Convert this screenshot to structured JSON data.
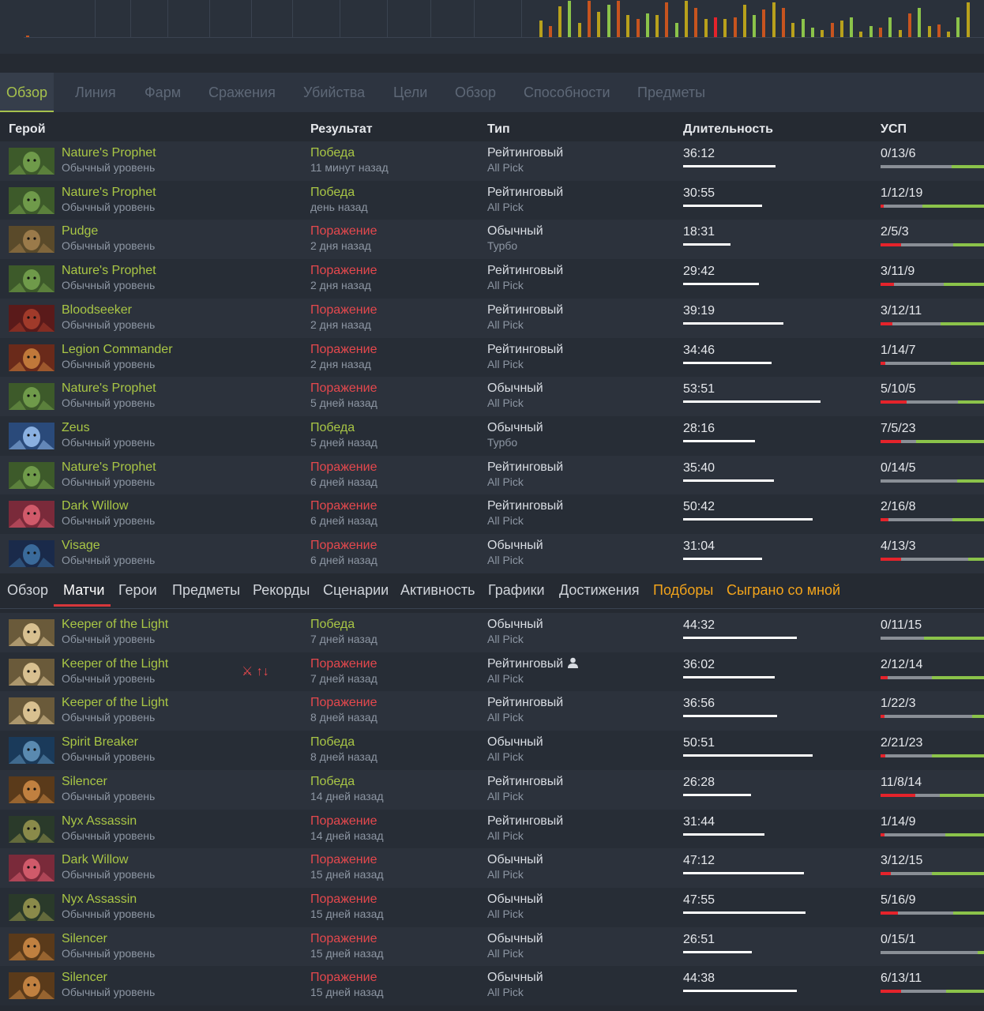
{
  "activity_chart": {
    "bars": [
      {
        "h": 0.45,
        "c": "#b8a11c"
      },
      {
        "h": 0.3,
        "c": "#c7541f"
      },
      {
        "h": 0.85,
        "c": "#b8a11c"
      },
      {
        "h": 1.0,
        "c": "#8bc34a"
      },
      {
        "h": 0.4,
        "c": "#b8a11c"
      },
      {
        "h": 1.0,
        "c": "#c7541f"
      },
      {
        "h": 0.7,
        "c": "#b8a11c"
      },
      {
        "h": 0.9,
        "c": "#8bc34a"
      },
      {
        "h": 1.0,
        "c": "#c7541f"
      },
      {
        "h": 0.6,
        "c": "#b8a11c"
      },
      {
        "h": 0.5,
        "c": "#c7541f"
      },
      {
        "h": 0.65,
        "c": "#8bc34a"
      },
      {
        "h": 0.6,
        "c": "#b8a11c"
      },
      {
        "h": 0.95,
        "c": "#c7541f"
      },
      {
        "h": 0.4,
        "c": "#8bc34a"
      },
      {
        "h": 1.0,
        "c": "#b8a11c"
      },
      {
        "h": 0.8,
        "c": "#c7541f"
      },
      {
        "h": 0.5,
        "c": "#b8a11c"
      },
      {
        "h": 0.55,
        "c": "#e5232b"
      },
      {
        "h": 0.5,
        "c": "#b8a11c"
      },
      {
        "h": 0.55,
        "c": "#c7541f"
      },
      {
        "h": 0.9,
        "c": "#b8a11c"
      },
      {
        "h": 0.6,
        "c": "#8bc34a"
      },
      {
        "h": 0.75,
        "c": "#c7541f"
      },
      {
        "h": 0.95,
        "c": "#b8a11c"
      },
      {
        "h": 0.8,
        "c": "#c7541f"
      },
      {
        "h": 0.4,
        "c": "#b8a11c"
      },
      {
        "h": 0.5,
        "c": "#8bc34a"
      },
      {
        "h": 0.25,
        "c": "#8bc34a"
      },
      {
        "h": 0.2,
        "c": "#b8a11c"
      },
      {
        "h": 0.4,
        "c": "#c7541f"
      },
      {
        "h": 0.45,
        "c": "#b8a11c"
      },
      {
        "h": 0.55,
        "c": "#8bc34a"
      },
      {
        "h": 0.15,
        "c": "#b8a11c"
      },
      {
        "h": 0.3,
        "c": "#8bc34a"
      },
      {
        "h": 0.25,
        "c": "#c7541f"
      },
      {
        "h": 0.55,
        "c": "#8bc34a"
      },
      {
        "h": 0.2,
        "c": "#b8a11c"
      },
      {
        "h": 0.65,
        "c": "#c7541f"
      },
      {
        "h": 0.8,
        "c": "#8bc34a"
      },
      {
        "h": 0.3,
        "c": "#b8a11c"
      },
      {
        "h": 0.35,
        "c": "#c7541f"
      },
      {
        "h": 0.15,
        "c": "#b8a11c"
      },
      {
        "h": 0.55,
        "c": "#8bc34a"
      },
      {
        "h": 0.95,
        "c": "#b8a11c"
      }
    ]
  },
  "top_tabs": [
    "Обзор",
    "Линия",
    "Фарм",
    "Сражения",
    "Убийства",
    "Цели",
    "Обзор",
    "Способности",
    "Предметы"
  ],
  "table_headers": {
    "hero": "Герой",
    "result": "Результат",
    "type": "Тип",
    "duration": "Длительность",
    "kda": "УСП"
  },
  "matches_top": [
    {
      "hero": "Nature's Prophet",
      "level": "Обычный уровень",
      "result": "Победа",
      "win": true,
      "when": "11 минут назад",
      "mode": "Рейтинговый",
      "sub": "All Pick",
      "duration": "36:12",
      "kda": "0/13/6",
      "k": 0,
      "d": 13,
      "a": 6
    },
    {
      "hero": "Nature's Prophet",
      "level": "Обычный уровень",
      "result": "Победа",
      "win": true,
      "when": "день назад",
      "mode": "Рейтинговый",
      "sub": "All Pick",
      "duration": "30:55",
      "kda": "1/12/19",
      "k": 1,
      "d": 12,
      "a": 19
    },
    {
      "hero": "Pudge",
      "level": "Обычный уровень",
      "result": "Поражение",
      "win": false,
      "when": "2 дня назад",
      "mode": "Обычный",
      "sub": "Турбо",
      "duration": "18:31",
      "kda": "2/5/3",
      "k": 2,
      "d": 5,
      "a": 3
    },
    {
      "hero": "Nature's Prophet",
      "level": "Обычный уровень",
      "result": "Поражение",
      "win": false,
      "when": "2 дня назад",
      "mode": "Рейтинговый",
      "sub": "All Pick",
      "duration": "29:42",
      "kda": "3/11/9",
      "k": 3,
      "d": 11,
      "a": 9
    },
    {
      "hero": "Bloodseeker",
      "level": "Обычный уровень",
      "result": "Поражение",
      "win": false,
      "when": "2 дня назад",
      "mode": "Рейтинговый",
      "sub": "All Pick",
      "duration": "39:19",
      "kda": "3/12/11",
      "k": 3,
      "d": 12,
      "a": 11
    },
    {
      "hero": "Legion Commander",
      "level": "Обычный уровень",
      "result": "Поражение",
      "win": false,
      "when": "2 дня назад",
      "mode": "Рейтинговый",
      "sub": "All Pick",
      "duration": "34:46",
      "kda": "1/14/7",
      "k": 1,
      "d": 14,
      "a": 7
    },
    {
      "hero": "Nature's Prophet",
      "level": "Обычный уровень",
      "result": "Поражение",
      "win": false,
      "when": "5 дней назад",
      "mode": "Обычный",
      "sub": "All Pick",
      "duration": "53:51",
      "kda": "5/10/5",
      "k": 5,
      "d": 10,
      "a": 5
    },
    {
      "hero": "Zeus",
      "level": "Обычный уровень",
      "result": "Победа",
      "win": true,
      "when": "5 дней назад",
      "mode": "Обычный",
      "sub": "Турбо",
      "duration": "28:16",
      "kda": "7/5/23",
      "k": 7,
      "d": 5,
      "a": 23
    },
    {
      "hero": "Nature's Prophet",
      "level": "Обычный уровень",
      "result": "Поражение",
      "win": false,
      "when": "6 дней назад",
      "mode": "Рейтинговый",
      "sub": "All Pick",
      "duration": "35:40",
      "kda": "0/14/5",
      "k": 0,
      "d": 14,
      "a": 5
    },
    {
      "hero": "Dark Willow",
      "level": "Обычный уровень",
      "result": "Поражение",
      "win": false,
      "when": "6 дней назад",
      "mode": "Рейтинговый",
      "sub": "All Pick",
      "duration": "50:42",
      "kda": "2/16/8",
      "k": 2,
      "d": 16,
      "a": 8
    },
    {
      "hero": "Visage",
      "level": "Обычный уровень",
      "result": "Поражение",
      "win": false,
      "when": "6 дней назад",
      "mode": "Обычный",
      "sub": "All Pick",
      "duration": "31:04",
      "kda": "4/13/3",
      "k": 4,
      "d": 13,
      "a": 3
    }
  ],
  "profile_nav": [
    "Обзор",
    "Матчи",
    "Герои",
    "Предметы",
    "Рекорды",
    "Сценарии",
    "Активность",
    "Графики",
    "Достижения",
    "Подборы",
    "Сыграно со мной"
  ],
  "matches_bottom": [
    {
      "hero": "Keeper of the Light",
      "level": "Обычный уровень",
      "result": "Победа",
      "win": true,
      "when": "7 дней назад",
      "mode": "Обычный",
      "sub": "All Pick",
      "duration": "44:32",
      "kda": "0/11/15",
      "k": 0,
      "d": 11,
      "a": 15
    },
    {
      "hero": "Keeper of the Light",
      "level": "Обычный уровень",
      "result": "Поражение",
      "win": false,
      "when": "7 дней назад",
      "mode": "Рейтинговый",
      "sub": "All Pick",
      "duration": "36:02",
      "kda": "2/12/14",
      "k": 2,
      "d": 12,
      "a": 14,
      "party": true,
      "extra": "⚔ ↑↓"
    },
    {
      "hero": "Keeper of the Light",
      "level": "Обычный уровень",
      "result": "Поражение",
      "win": false,
      "when": "8 дней назад",
      "mode": "Рейтинговый",
      "sub": "All Pick",
      "duration": "36:56",
      "kda": "1/22/3",
      "k": 1,
      "d": 22,
      "a": 3
    },
    {
      "hero": "Spirit Breaker",
      "level": "Обычный уровень",
      "result": "Победа",
      "win": true,
      "when": "8 дней назад",
      "mode": "Обычный",
      "sub": "All Pick",
      "duration": "50:51",
      "kda": "2/21/23",
      "k": 2,
      "d": 21,
      "a": 23
    },
    {
      "hero": "Silencer",
      "level": "Обычный уровень",
      "result": "Победа",
      "win": true,
      "when": "14 дней назад",
      "mode": "Рейтинговый",
      "sub": "All Pick",
      "duration": "26:28",
      "kda": "11/8/14",
      "k": 11,
      "d": 8,
      "a": 14
    },
    {
      "hero": "Nyx Assassin",
      "level": "Обычный уровень",
      "result": "Поражение",
      "win": false,
      "when": "14 дней назад",
      "mode": "Рейтинговый",
      "sub": "All Pick",
      "duration": "31:44",
      "kda": "1/14/9",
      "k": 1,
      "d": 14,
      "a": 9
    },
    {
      "hero": "Dark Willow",
      "level": "Обычный уровень",
      "result": "Поражение",
      "win": false,
      "when": "15 дней назад",
      "mode": "Обычный",
      "sub": "All Pick",
      "duration": "47:12",
      "kda": "3/12/15",
      "k": 3,
      "d": 12,
      "a": 15
    },
    {
      "hero": "Nyx Assassin",
      "level": "Обычный уровень",
      "result": "Поражение",
      "win": false,
      "when": "15 дней назад",
      "mode": "Обычный",
      "sub": "All Pick",
      "duration": "47:55",
      "kda": "5/16/9",
      "k": 5,
      "d": 16,
      "a": 9
    },
    {
      "hero": "Silencer",
      "level": "Обычный уровень",
      "result": "Поражение",
      "win": false,
      "when": "15 дней назад",
      "mode": "Обычный",
      "sub": "All Pick",
      "duration": "26:51",
      "kda": "0/15/1",
      "k": 0,
      "d": 15,
      "a": 1
    },
    {
      "hero": "Silencer",
      "level": "Обычный уровень",
      "result": "Поражение",
      "win": false,
      "when": "15 дней назад",
      "mode": "Обычный",
      "sub": "All Pick",
      "duration": "44:38",
      "kda": "6/13/11",
      "k": 6,
      "d": 13,
      "a": 11
    }
  ],
  "hero_colors": {
    "Nature's Prophet": [
      "#3d5a2a",
      "#6f9a4a"
    ],
    "Pudge": [
      "#5a4a2a",
      "#9a7a4a"
    ],
    "Bloodseeker": [
      "#5a1a1a",
      "#a03a2a"
    ],
    "Legion Commander": [
      "#6a2a1a",
      "#c0783a"
    ],
    "Zeus": [
      "#2a4a7a",
      "#8ab0e0"
    ],
    "Dark Willow": [
      "#7a2a3a",
      "#d05a6a"
    ],
    "Visage": [
      "#1a2a4a",
      "#3a6a9a"
    ],
    "Keeper of the Light": [
      "#6a5a3a",
      "#d8c090"
    ],
    "Spirit Breaker": [
      "#1a3a5a",
      "#5a8ab0"
    ],
    "Silencer": [
      "#5a3a1a",
      "#c08040"
    ],
    "Nyx Assassin": [
      "#2a3a2a",
      "#8a8a4a"
    ]
  }
}
